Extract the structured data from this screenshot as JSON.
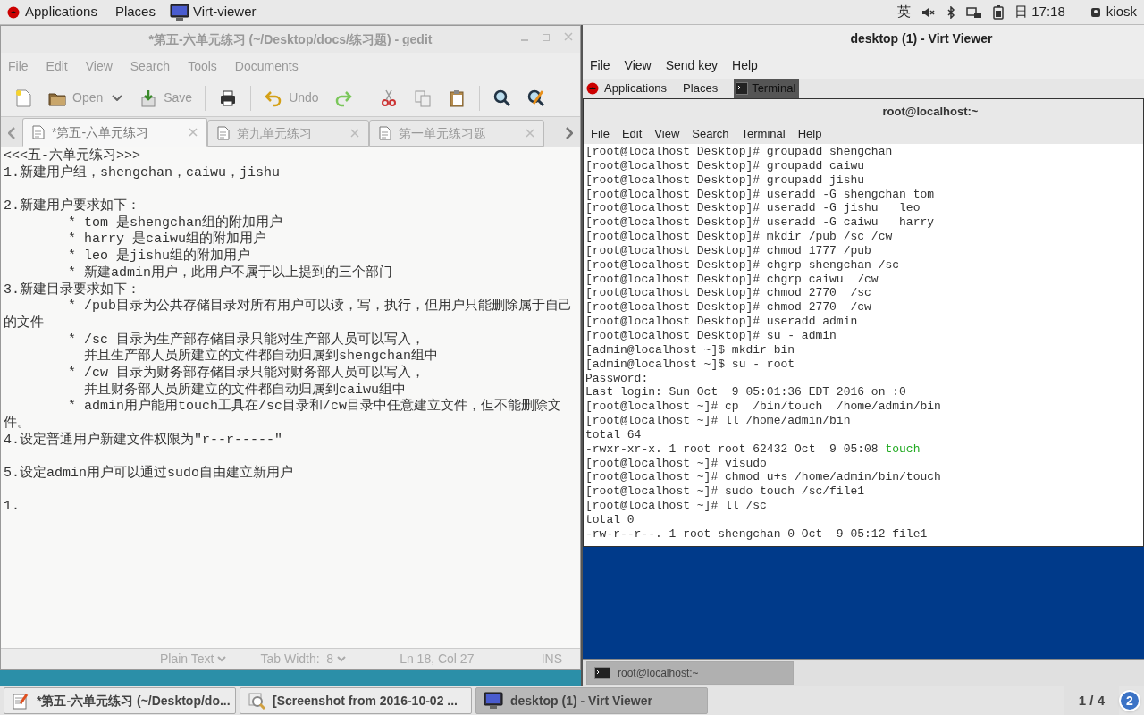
{
  "top_bar": {
    "applications": "Applications",
    "places": "Places",
    "app": "Virt-viewer",
    "input_method": "英",
    "clock": "日 17:18",
    "user": "kiosk"
  },
  "gedit": {
    "title": "*第五-六单元练习 (~/Desktop/docs/练习题) - gedit",
    "active": false,
    "menu": [
      "File",
      "Edit",
      "View",
      "Search",
      "Tools",
      "Documents"
    ],
    "toolbar": [
      {
        "kind": "new"
      },
      {
        "kind": "open",
        "label": "Open"
      },
      {
        "kind": "dropdown"
      },
      {
        "kind": "save",
        "label": "Save"
      },
      {
        "kind": "print"
      },
      {
        "kind": "undo",
        "label": "Undo"
      },
      {
        "kind": "redo"
      },
      {
        "kind": "cut"
      },
      {
        "kind": "copy"
      },
      {
        "kind": "paste"
      },
      {
        "kind": "search"
      },
      {
        "kind": "replace"
      }
    ],
    "tabs": [
      {
        "label": "*第五-六单元练习",
        "selected": true
      },
      {
        "label": "第九单元练习",
        "selected": false
      },
      {
        "label": "第一单元练习题",
        "selected": false
      }
    ],
    "lines": [
      "<<<五-六单元练习>>>",
      {
        "text": "1.新建用户组，shengchan，caiwu，jishu",
        "space_after": true
      },
      "2.新建用户要求如下：",
      "\t* tom 是shengchan组的附加用户",
      "\t* harry 是caiwu组的附加用户",
      "\t* leo 是jishu组的附加用户",
      "\t* 新建admin用户，此用户不属于以上提到的三个部门",
      "3.新建目录要求如下：",
      "\t* /pub目录为公共存储目录对所有用户可以读，写，执行，但用户只能删除属于自己",
      "的文件",
      "\t* /sc 目录为生产部存储目录只能对生产部人员可以写入，",
      "\t  并且生产部人员所建立的文件都自动归属到shengchan组中",
      "\t* /cw 目录为财务部存储目录只能对财务部人员可以写入，",
      "\t  并且财务部人员所建立的文件都自动归属到caiwu组中",
      "\t* admin用户能用touch工具在/sc目录和/cw目录中任意建立文件，但不能删除文",
      "件。",
      {
        "text": "4.设定普通用户新建文件权限为\"r--r-----\"",
        "space_after": true
      },
      {
        "text": "5.设定admin用户可以通过sudo自由建立新用户",
        "space_after": true
      },
      "1."
    ],
    "status": {
      "language": "Plain Text",
      "tab_width": "Tab Width:  8",
      "position": "Ln 18, Col 27",
      "mode": "INS"
    }
  },
  "virt_viewer": {
    "title": "desktop (1) - Virt Viewer",
    "active": true,
    "menu": [
      "File",
      "View",
      "Send key",
      "Help"
    ],
    "guest": {
      "top_bar": {
        "applications": "Applications",
        "places": "Places",
        "app": "Terminal"
      },
      "terminal": {
        "title": "root@localhost:~",
        "menu": [
          "File",
          "Edit",
          "View",
          "Search",
          "Terminal",
          "Help"
        ],
        "lines": [
          {
            "text": "[root@localhost Desktop]# groupadd shengchan"
          },
          {
            "text": "[root@localhost Desktop]# groupadd caiwu"
          },
          {
            "text": "[root@localhost Desktop]# groupadd jishu"
          },
          {
            "text": "[root@localhost Desktop]# useradd -G shengchan tom"
          },
          {
            "text": "[root@localhost Desktop]# useradd -G jishu   leo"
          },
          {
            "text": "[root@localhost Desktop]# useradd -G caiwu   harry"
          },
          {
            "text": "[root@localhost Desktop]# mkdir /pub /sc /cw"
          },
          {
            "text": "[root@localhost Desktop]# chmod 1777 /pub"
          },
          {
            "text": "[root@localhost Desktop]# chgrp shengchan /sc"
          },
          {
            "text": "[root@localhost Desktop]# chgrp caiwu  /cw"
          },
          {
            "text": "[root@localhost Desktop]# chmod 2770  /sc"
          },
          {
            "text": "[root@localhost Desktop]# chmod 2770  /cw"
          },
          {
            "text": "[root@localhost Desktop]# useradd admin"
          },
          {
            "text": "[root@localhost Desktop]# su - admin"
          },
          {
            "text": "[admin@localhost ~]$ mkdir bin"
          },
          {
            "text": "[admin@localhost ~]$ su - root"
          },
          {
            "text": "Password:"
          },
          {
            "text": "Last login: Sun Oct  9 05:01:36 EDT 2016 on :0"
          },
          {
            "text": "[root@localhost ~]# cp  /bin/touch  /home/admin/bin"
          },
          {
            "text": "[root@localhost ~]# ll /home/admin/bin"
          },
          {
            "text": "total 64"
          },
          {
            "text": "-rwxr-xr-x. 1 root root 62432 Oct  9 05:08",
            "file": "touch"
          },
          {
            "text": "[root@localhost ~]# visudo"
          },
          {
            "text": "[root@localhost ~]# chmod u+s /home/admin/bin/touch"
          },
          {
            "text": "[root@localhost ~]# sudo touch /sc/file1"
          },
          {
            "text": "[root@localhost ~]# ll /sc"
          },
          {
            "text": "total 0"
          },
          {
            "text": "-rw-r--r--. 1 root shengchan 0 Oct  9 05:12 file1"
          }
        ]
      },
      "taskbar": [
        {
          "label": "root@localhost:~",
          "selected": true
        }
      ]
    }
  },
  "taskbar": {
    "items": [
      {
        "label": "*第五-六单元练习 (~/Desktop/do...",
        "selected": false
      },
      {
        "label": "[Screenshot from 2016-10-02 ...",
        "selected": false
      },
      {
        "label": "desktop (1) - Virt Viewer",
        "selected": true
      }
    ],
    "workspace": "1 / 4",
    "badge": "2"
  }
}
